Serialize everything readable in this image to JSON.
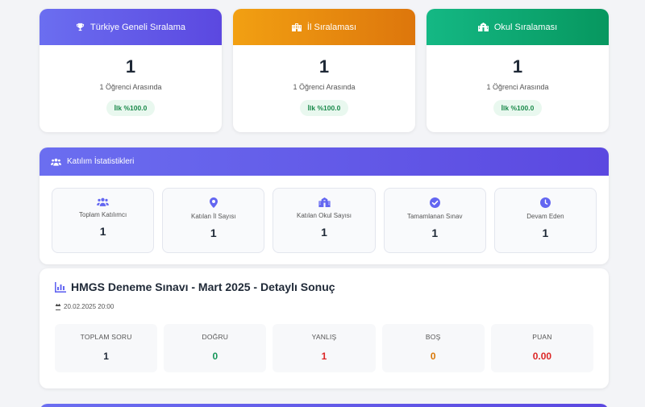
{
  "rankings": [
    {
      "title": "Türkiye Geneli Sıralama",
      "icon": "trophy-icon",
      "value": "1",
      "sub": "1 Öğrenci Arasında",
      "badge": "İlk %100.0"
    },
    {
      "title": "İl Sıralaması",
      "icon": "city-icon",
      "value": "1",
      "sub": "1 Öğrenci Arasında",
      "badge": "İlk %100.0"
    },
    {
      "title": "Okul Sıralaması",
      "icon": "school-icon",
      "value": "1",
      "sub": "1 Öğrenci Arasında",
      "badge": "İlk %100.0"
    }
  ],
  "participation": {
    "title": "Katılım İstatistikleri",
    "icon": "users-icon",
    "stats": [
      {
        "label": "Toplam Katılımcı",
        "value": "1",
        "icon": "users-icon"
      },
      {
        "label": "Katılan İl Sayısı",
        "value": "1",
        "icon": "map-pin-icon"
      },
      {
        "label": "Katılan Okul Sayısı",
        "value": "1",
        "icon": "school-icon"
      },
      {
        "label": "Tamamlanan Sınav",
        "value": "1",
        "icon": "check-circle-icon"
      },
      {
        "label": "Devam Eden",
        "value": "1",
        "icon": "clock-icon"
      }
    ]
  },
  "exam": {
    "title": "HMGS Deneme Sınavı - Mart 2025 - Detaylı Sonuç",
    "icon": "chart-icon",
    "date": "20.02.2025 20:00",
    "scores": [
      {
        "label": "TOPLAM SORU",
        "value": "1",
        "color": "#1f2937"
      },
      {
        "label": "DOĞRU",
        "value": "0",
        "color": "#15965a"
      },
      {
        "label": "YANLIŞ",
        "value": "1",
        "color": "#dc2626"
      },
      {
        "label": "BOŞ",
        "value": "0",
        "color": "#d97706"
      },
      {
        "label": "PUAN",
        "value": "0.00",
        "color": "#dc2626"
      }
    ]
  },
  "colors": {
    "primary": "#5b48e0",
    "orange": "#f2a012",
    "green": "#14b884"
  }
}
